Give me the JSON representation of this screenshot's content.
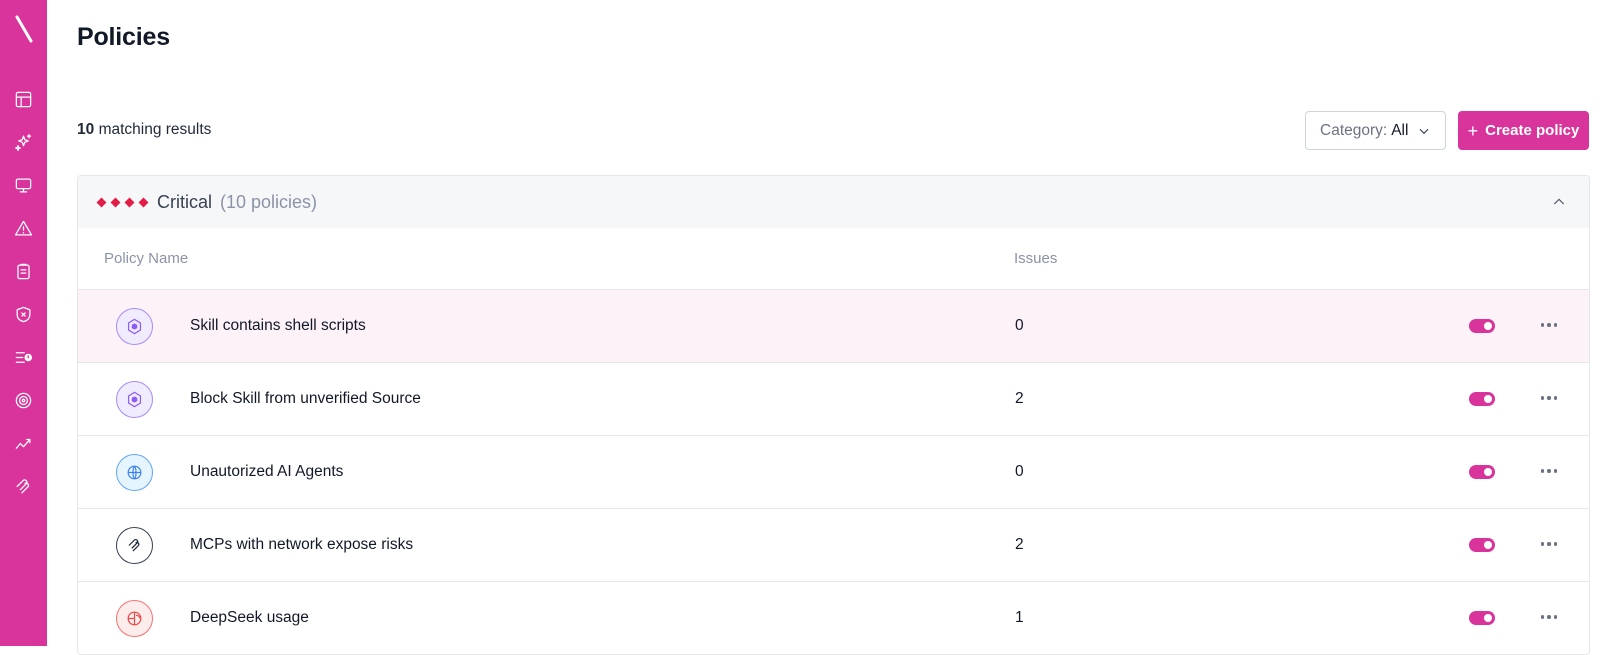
{
  "sidebar": {
    "logo": "\\",
    "items": [
      {
        "name": "dashboard-icon"
      },
      {
        "name": "ai-sparkles-icon"
      },
      {
        "name": "monitor-icon"
      },
      {
        "name": "alert-triangle-icon"
      },
      {
        "name": "clipboard-icon"
      },
      {
        "name": "shield-x-icon"
      },
      {
        "name": "list-alert-icon"
      },
      {
        "name": "radar-icon"
      },
      {
        "name": "trend-chart-icon"
      },
      {
        "name": "mcp-icon"
      }
    ]
  },
  "page": {
    "title": "Policies",
    "results_count": "10",
    "results_label": "matching results"
  },
  "toolbar": {
    "category_label": "Category:",
    "category_value": "All",
    "create_label": "Create policy"
  },
  "group": {
    "title": "Critical",
    "count": "(10 policies)",
    "color": "#e11d48"
  },
  "table": {
    "columns": [
      "Policy Name",
      "Issues"
    ],
    "rows": [
      {
        "name": "Skill contains shell scripts",
        "issues": "0",
        "icon": "skill-hexagon-icon",
        "enabled": true
      },
      {
        "name": "Block Skill from unverified Source",
        "issues": "2",
        "icon": "skill-hexagon-icon",
        "enabled": true
      },
      {
        "name": "Unautorized AI Agents",
        "issues": "0",
        "icon": "globe-icon",
        "enabled": true
      },
      {
        "name": "MCPs with network expose risks",
        "issues": "2",
        "icon": "mcp-icon",
        "enabled": true
      },
      {
        "name": "DeepSeek usage",
        "issues": "1",
        "icon": "deepseek-icon",
        "enabled": true
      }
    ]
  },
  "colors": {
    "brand": "#d9349b",
    "highlight_row": "#fdf2f8"
  }
}
